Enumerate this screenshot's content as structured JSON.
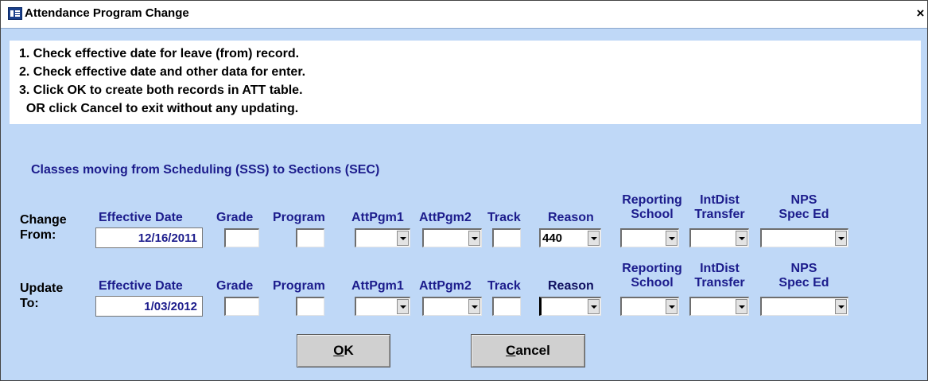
{
  "window": {
    "title": "Attendance Program Change",
    "close": "×"
  },
  "instructions": [
    "1.  Check effective date for leave (from) record.",
    "2.  Check effective date and other data for enter.",
    "3.  Click OK to create both records in ATT table.",
    "  OR click Cancel to exit without any updating."
  ],
  "subtitle": "Classes moving from Scheduling (SSS) to Sections (SEC)",
  "columns": {
    "effective_date": "Effective Date",
    "grade": "Grade",
    "program": "Program",
    "attpgm1": "AttPgm1",
    "attpgm2": "AttPgm2",
    "track": "Track",
    "reason": "Reason",
    "reporting_school": [
      "Reporting",
      "School"
    ],
    "intdist_transfer": [
      "IntDist",
      "Transfer"
    ],
    "nps_spec_ed": [
      "NPS",
      "Spec Ed"
    ]
  },
  "rows": {
    "from": {
      "label": [
        "Change",
        "From:"
      ],
      "effective_date": "12/16/2011",
      "grade": "",
      "program": "",
      "attpgm1": "",
      "attpgm2": "",
      "track": "",
      "reason": "440",
      "reporting_school": "",
      "intdist_transfer": "",
      "nps_spec_ed": ""
    },
    "to": {
      "label": [
        "Update",
        "To:"
      ],
      "effective_date": "1/03/2012",
      "grade": "",
      "program": "",
      "attpgm1": "",
      "attpgm2": "",
      "track": "",
      "reason": "",
      "reporting_school": "",
      "intdist_transfer": "",
      "nps_spec_ed": ""
    }
  },
  "buttons": {
    "ok_hotkey": "O",
    "ok_rest": "K",
    "cancel_hotkey": "C",
    "cancel_rest": "ancel"
  }
}
